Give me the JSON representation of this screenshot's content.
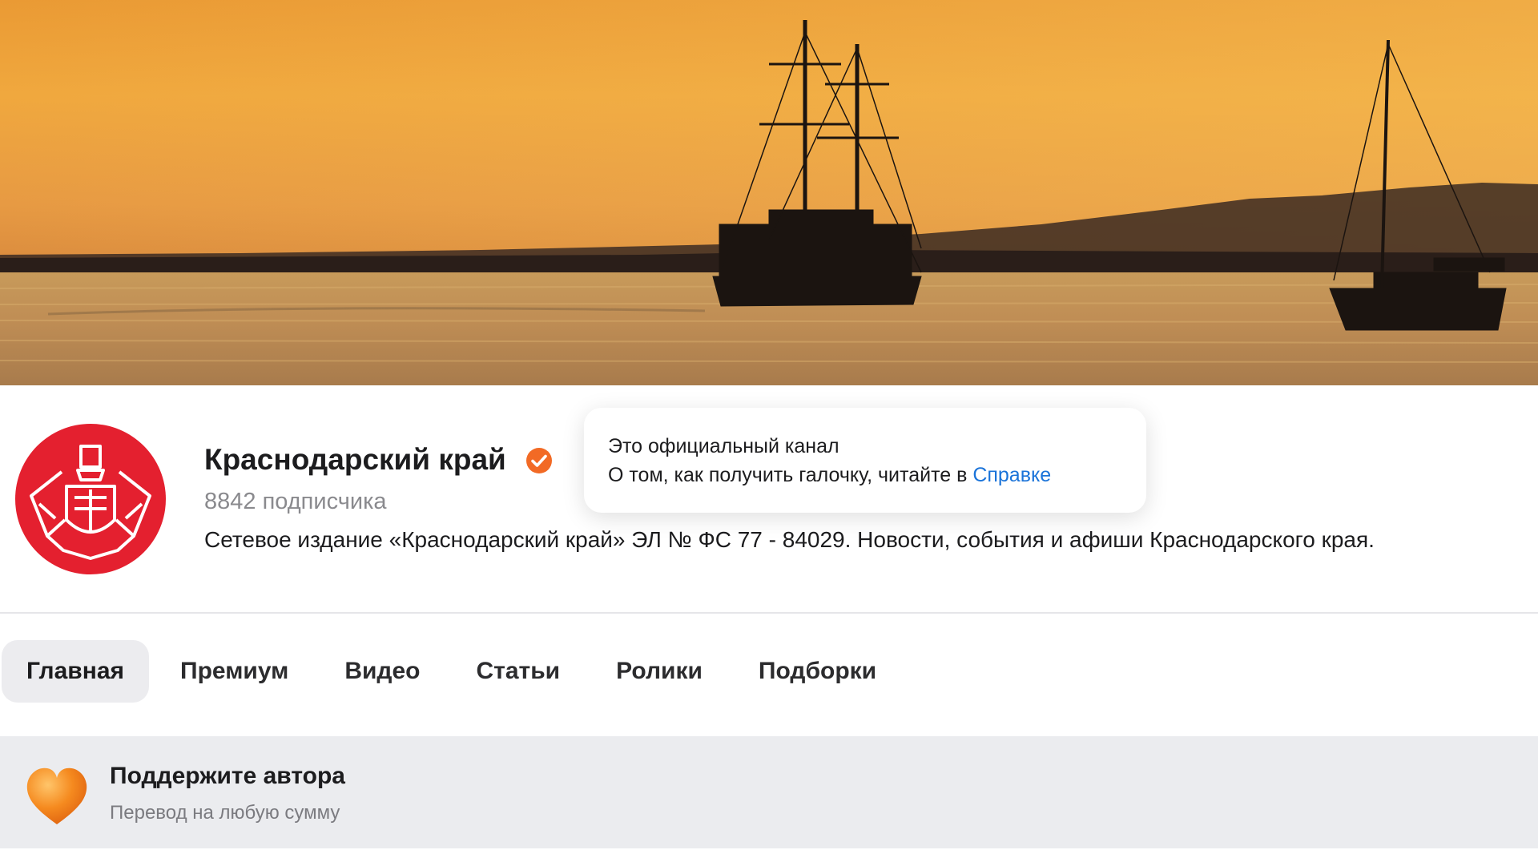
{
  "channel": {
    "name": "Краснодарский край",
    "subscribers": "8842 подписчика",
    "description": "Сетевое издание «Краснодарский край» ЭЛ № ФС 77 - 84029. Новости, события и афиши Краснодарского края.",
    "avatar_color": "#e4202f",
    "verified_color": "#f26a25"
  },
  "tooltip": {
    "line1": "Это официальный канал",
    "line2_prefix": "О том, как получить галочку, читайте в ",
    "link_text": "Справке",
    "link_color": "#1a73d9"
  },
  "tabs": [
    {
      "label": "Главная",
      "active": true
    },
    {
      "label": "Премиум",
      "active": false
    },
    {
      "label": "Видео",
      "active": false
    },
    {
      "label": "Статьи",
      "active": false
    },
    {
      "label": "Ролики",
      "active": false
    },
    {
      "label": "Подборки",
      "active": false
    }
  ],
  "support": {
    "title": "Поддержите автора",
    "subtitle": "Перевод на любую сумму",
    "icon": "heart-icon",
    "icon_color": "#f58a1f"
  },
  "banner": {
    "icon": "sunset-sailboats-image"
  }
}
